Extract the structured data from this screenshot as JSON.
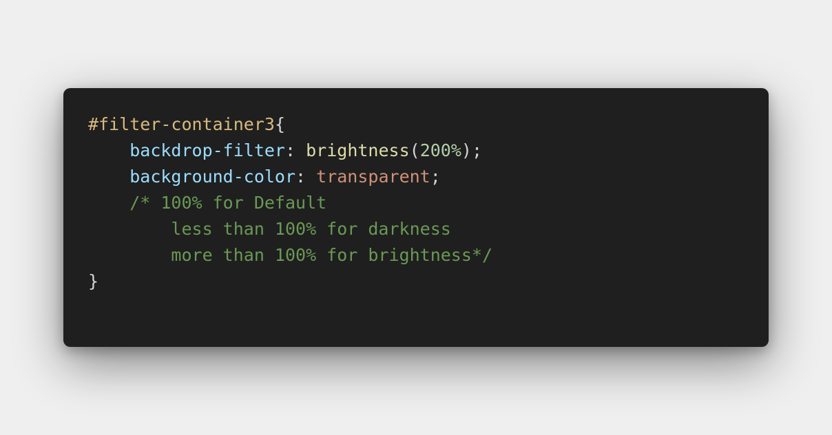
{
  "code": {
    "line1": {
      "selector": "#filter-container3",
      "brace_open": "{"
    },
    "line2": {
      "indent": "    ",
      "property": "backdrop-filter",
      "colon": ": ",
      "func": "brightness",
      "paren_open": "(",
      "arg": "200%",
      "paren_close": ")",
      "semicolon": ";"
    },
    "line3": {
      "indent": "    ",
      "property": "background-color",
      "colon": ": ",
      "value": "transparent",
      "semicolon": ";"
    },
    "comment": {
      "line1": "    /* 100% for Default",
      "line2": "        less than 100% for darkness",
      "line3": "        more than 100% for brightness*/"
    },
    "brace_close": "}"
  },
  "colors": {
    "background": "#efefef",
    "card": "#1f1f1f",
    "selector": "#d7ba7d",
    "property": "#9cdcfe",
    "function": "#dcdcaa",
    "number": "#b5cea8",
    "string_value": "#ce9178",
    "comment": "#6a9955",
    "punctuation": "#d4d4d4"
  }
}
